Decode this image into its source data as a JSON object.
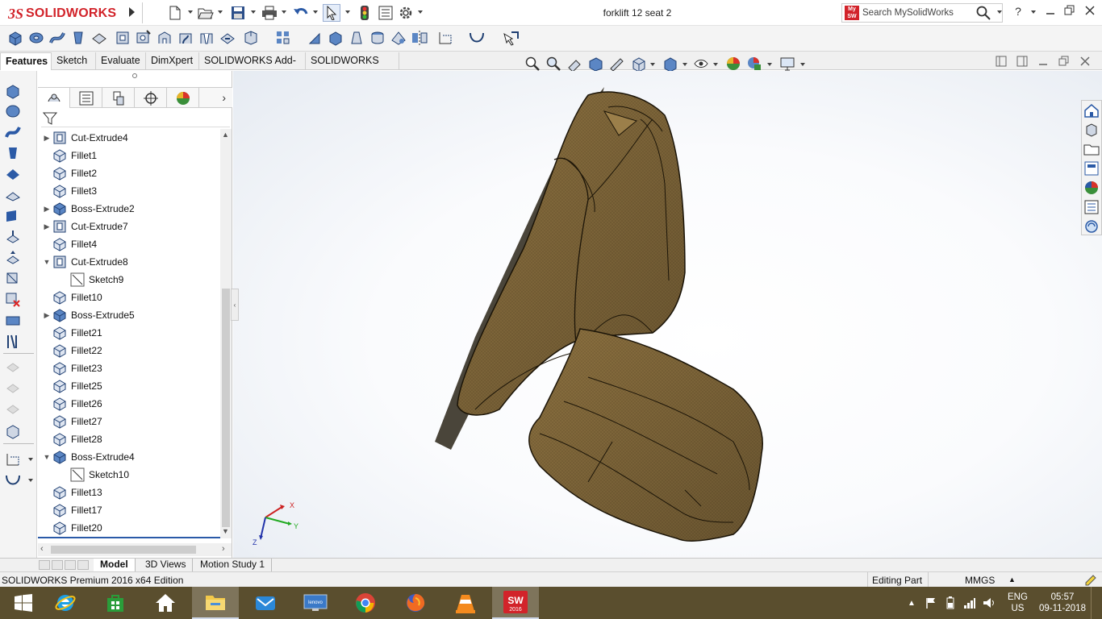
{
  "app": {
    "brand_ds": "3S",
    "brand_name": "SOLIDWORKS",
    "document_title": "forklift 12 seat 2",
    "search_placeholder": "Search MySolidWorks",
    "help_label": "?",
    "logo_badge": "My SW"
  },
  "tabs": [
    "Features",
    "Sketch",
    "Evaluate",
    "DimXpert",
    "SOLIDWORKS Add-Ins",
    "SOLIDWORKS MBD"
  ],
  "active_tab": "Features",
  "tree": [
    {
      "label": "Cut-Extrude4",
      "type": "cut",
      "expand": "collapsed",
      "indent": 0
    },
    {
      "label": "Fillet1",
      "type": "fillet",
      "expand": "none",
      "indent": 0
    },
    {
      "label": "Fillet2",
      "type": "fillet",
      "expand": "none",
      "indent": 0
    },
    {
      "label": "Fillet3",
      "type": "fillet",
      "expand": "none",
      "indent": 0
    },
    {
      "label": "Boss-Extrude2",
      "type": "boss",
      "expand": "collapsed",
      "indent": 0
    },
    {
      "label": "Cut-Extrude7",
      "type": "cut",
      "expand": "collapsed",
      "indent": 0
    },
    {
      "label": "Fillet4",
      "type": "fillet",
      "expand": "none",
      "indent": 0
    },
    {
      "label": "Cut-Extrude8",
      "type": "cut",
      "expand": "expanded",
      "indent": 0
    },
    {
      "label": "Sketch9",
      "type": "sketch",
      "expand": "none",
      "indent": 1
    },
    {
      "label": "Fillet10",
      "type": "fillet",
      "expand": "none",
      "indent": 0
    },
    {
      "label": "Boss-Extrude5",
      "type": "boss",
      "expand": "collapsed",
      "indent": 0
    },
    {
      "label": "Fillet21",
      "type": "fillet",
      "expand": "none",
      "indent": 0
    },
    {
      "label": "Fillet22",
      "type": "fillet",
      "expand": "none",
      "indent": 0
    },
    {
      "label": "Fillet23",
      "type": "fillet",
      "expand": "none",
      "indent": 0
    },
    {
      "label": "Fillet25",
      "type": "fillet",
      "expand": "none",
      "indent": 0
    },
    {
      "label": "Fillet26",
      "type": "fillet",
      "expand": "none",
      "indent": 0
    },
    {
      "label": "Fillet27",
      "type": "fillet",
      "expand": "none",
      "indent": 0
    },
    {
      "label": "Fillet28",
      "type": "fillet",
      "expand": "none",
      "indent": 0
    },
    {
      "label": "Boss-Extrude4",
      "type": "boss",
      "expand": "expanded",
      "indent": 0
    },
    {
      "label": "Sketch10",
      "type": "sketch",
      "expand": "none",
      "indent": 1
    },
    {
      "label": "Fillet13",
      "type": "fillet",
      "expand": "none",
      "indent": 0
    },
    {
      "label": "Fillet17",
      "type": "fillet",
      "expand": "none",
      "indent": 0
    },
    {
      "label": "Fillet20",
      "type": "fillet",
      "expand": "none",
      "indent": 0
    }
  ],
  "bottom_tabs": [
    "Model",
    "3D Views",
    "Motion Study 1"
  ],
  "active_bottom_tab": "Model",
  "status": {
    "edition": "SOLIDWORKS Premium 2016 x64 Edition",
    "mode": "Editing Part",
    "units": "MMGS"
  },
  "triad": {
    "x": "X",
    "y": "Y",
    "z": "Z"
  },
  "taskbar": {
    "lang_top": "ENG",
    "lang_bottom": "US",
    "time": "05:57",
    "date": "09-11-2018",
    "sw_badge": "2016",
    "lenovo_label": "lenovo"
  },
  "colors": {
    "brand_red": "#d2232a",
    "model_fill": "#8a6d3b",
    "taskbar": "#5a4e2e"
  }
}
